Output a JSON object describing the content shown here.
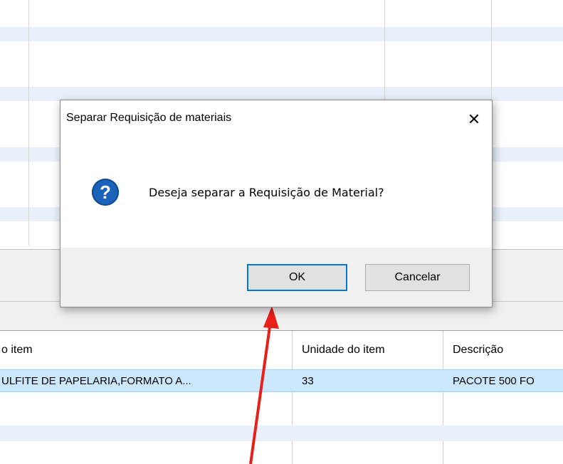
{
  "dialog": {
    "title": "Separar Requisição de materiais",
    "close_symbol": "✕",
    "message": "Deseja separar a Requisição de Material?",
    "icon": "question-icon",
    "ok_label": "OK",
    "cancel_label": "Cancelar"
  },
  "lower_grid": {
    "headers": [
      "o item",
      "Unidade do item",
      "Descrição"
    ],
    "rows": [
      {
        "item": "ULFITE DE PAPELARIA,FORMATO A...",
        "unidade": "33",
        "descricao": "PACOTE 500  FO"
      }
    ]
  },
  "colors": {
    "selection": "#cce8ff",
    "band": "#e9f0fb",
    "ok_focus": "#0078d7",
    "question_icon": "#1a63b8",
    "arrow": "#e8201a"
  }
}
